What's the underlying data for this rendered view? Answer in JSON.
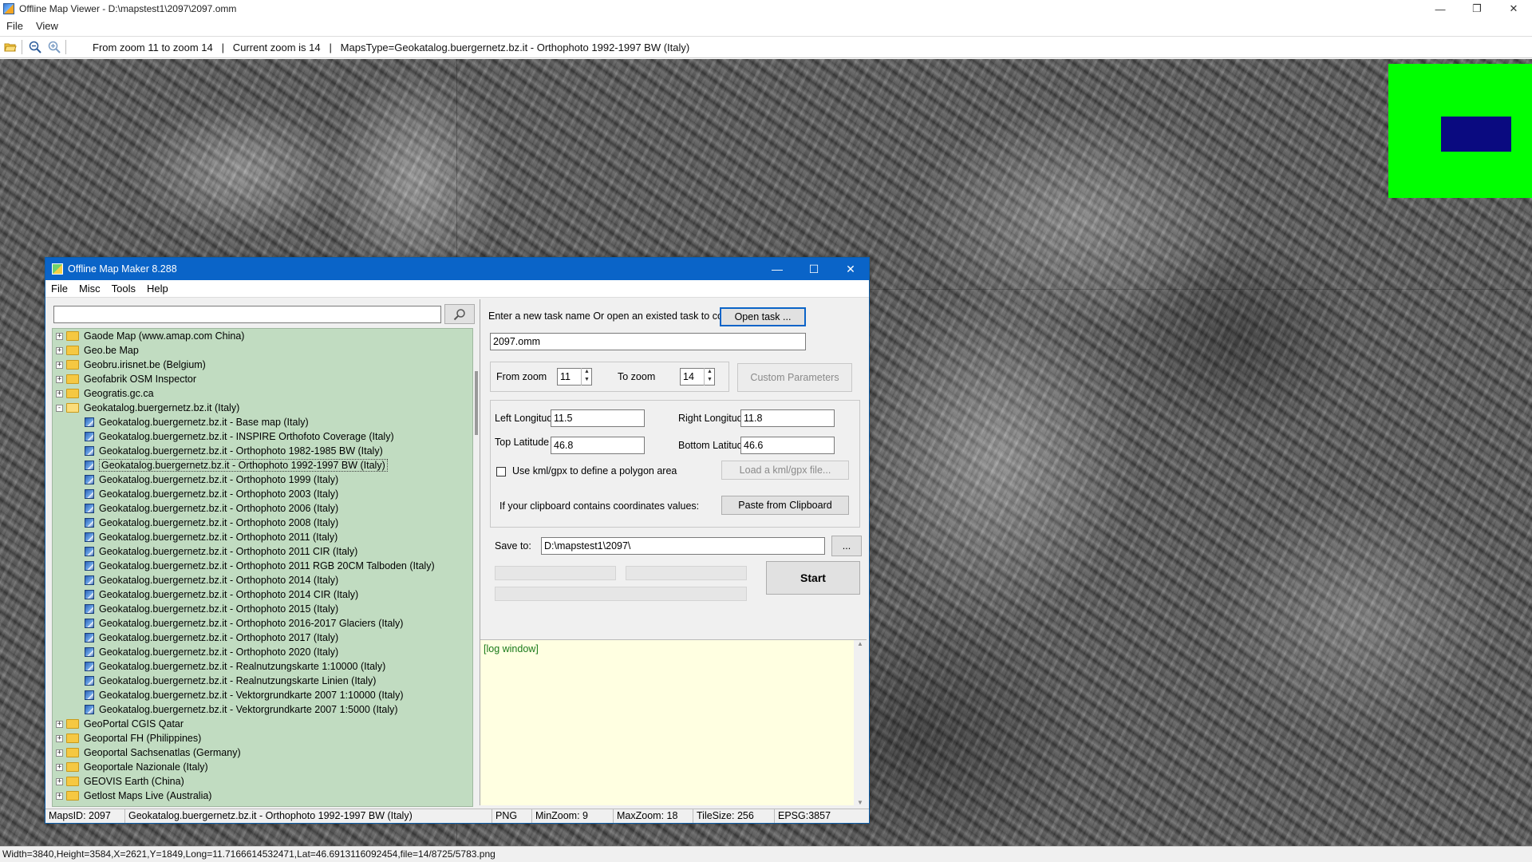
{
  "viewer": {
    "title": "Offline Map Viewer - D:\\mapstest1\\2097\\2097.omm",
    "menu": [
      "File",
      "View"
    ],
    "toolbar_status": "From zoom 11 to zoom 14   |   Current zoom is 14   |   MapsType=Geokatalog.buergernetz.bz.it - Orthophoto 1992-1997 BW (Italy)",
    "statusbar": "Width=3840,Height=3584,X=2621,Y=1849,Long=11.7166614532471,Lat=46.6913116092454,file=14/8725/5783.png",
    "icons": {
      "open": "folder-open-icon",
      "zoom_out": "zoom-out-icon",
      "zoom_in": "zoom-in-icon"
    },
    "colors": {
      "minimap_bg": "#00ff00",
      "minimap_viewport": "#0a0a80"
    }
  },
  "dialog": {
    "title": "Offline Map Maker 8.288",
    "menu": [
      "File",
      "Misc",
      "Tools",
      "Help"
    ],
    "search": {
      "value": "",
      "placeholder": ""
    },
    "tree": [
      {
        "label": "Gaode Map (www.amap.com China)",
        "type": "folder",
        "expanded": false
      },
      {
        "label": "Geo.be Map",
        "type": "folder",
        "expanded": false
      },
      {
        "label": "Geobru.irisnet.be (Belgium)",
        "type": "folder",
        "expanded": false
      },
      {
        "label": "Geofabrik OSM Inspector",
        "type": "folder",
        "expanded": false
      },
      {
        "label": "Geogratis.gc.ca",
        "type": "folder",
        "expanded": false
      },
      {
        "label": "Geokatalog.buergernetz.bz.it (Italy)",
        "type": "folder",
        "expanded": true
      },
      {
        "label": "Geokatalog.buergernetz.bz.it - Base map (Italy)",
        "type": "map"
      },
      {
        "label": "Geokatalog.buergernetz.bz.it - INSPIRE Orthofoto Coverage (Italy)",
        "type": "map"
      },
      {
        "label": "Geokatalog.buergernetz.bz.it - Orthophoto 1982-1985 BW (Italy)",
        "type": "map"
      },
      {
        "label": "Geokatalog.buergernetz.bz.it - Orthophoto 1992-1997 BW (Italy)",
        "type": "map",
        "selected": true
      },
      {
        "label": "Geokatalog.buergernetz.bz.it - Orthophoto 1999 (Italy)",
        "type": "map"
      },
      {
        "label": "Geokatalog.buergernetz.bz.it - Orthophoto 2003 (Italy)",
        "type": "map"
      },
      {
        "label": "Geokatalog.buergernetz.bz.it - Orthophoto 2006 (Italy)",
        "type": "map"
      },
      {
        "label": "Geokatalog.buergernetz.bz.it - Orthophoto 2008 (Italy)",
        "type": "map"
      },
      {
        "label": "Geokatalog.buergernetz.bz.it - Orthophoto 2011 (Italy)",
        "type": "map"
      },
      {
        "label": "Geokatalog.buergernetz.bz.it - Orthophoto 2011 CIR (Italy)",
        "type": "map"
      },
      {
        "label": "Geokatalog.buergernetz.bz.it - Orthophoto 2011 RGB 20CM Talboden (Italy)",
        "type": "map"
      },
      {
        "label": "Geokatalog.buergernetz.bz.it - Orthophoto 2014 (Italy)",
        "type": "map"
      },
      {
        "label": "Geokatalog.buergernetz.bz.it - Orthophoto 2014 CIR (Italy)",
        "type": "map"
      },
      {
        "label": "Geokatalog.buergernetz.bz.it - Orthophoto 2015 (Italy)",
        "type": "map"
      },
      {
        "label": "Geokatalog.buergernetz.bz.it - Orthophoto 2016-2017 Glaciers (Italy)",
        "type": "map"
      },
      {
        "label": "Geokatalog.buergernetz.bz.it - Orthophoto 2017 (Italy)",
        "type": "map"
      },
      {
        "label": "Geokatalog.buergernetz.bz.it - Orthophoto 2020 (Italy)",
        "type": "map"
      },
      {
        "label": "Geokatalog.buergernetz.bz.it - Realnutzungskarte 1:10000 (Italy)",
        "type": "map"
      },
      {
        "label": "Geokatalog.buergernetz.bz.it - Realnutzungskarte Linien (Italy)",
        "type": "map"
      },
      {
        "label": "Geokatalog.buergernetz.bz.it - Vektorgrundkarte 2007 1:10000 (Italy)",
        "type": "map"
      },
      {
        "label": "Geokatalog.buergernetz.bz.it - Vektorgrundkarte 2007 1:5000 (Italy)",
        "type": "map"
      },
      {
        "label": "GeoPortal CGIS Qatar",
        "type": "folder",
        "expanded": false
      },
      {
        "label": "Geoportal FH (Philippines)",
        "type": "folder",
        "expanded": false
      },
      {
        "label": "Geoportal Sachsenatlas (Germany)",
        "type": "folder",
        "expanded": false
      },
      {
        "label": "Geoportale Nazionale (Italy)",
        "type": "folder",
        "expanded": false
      },
      {
        "label": "GEOVIS Earth (China)",
        "type": "folder",
        "expanded": false
      },
      {
        "label": "Getlost Maps Live (Australia)",
        "type": "folder",
        "expanded": false
      }
    ],
    "task": {
      "prompt": "Enter a new task name Or open an existed task to continue:",
      "open_label": "Open task ...",
      "name": "2097.omm"
    },
    "zoom": {
      "from_label": "From zoom",
      "from_value": "11",
      "to_label": "To zoom",
      "to_value": "14",
      "custom_label": "Custom Parameters"
    },
    "coords": {
      "left_lon_label": "Left Longitude",
      "left_lon": "11.5",
      "right_lon_label": "Right Longitude",
      "right_lon": "11.8",
      "top_lat_label": "Top Latitude",
      "top_lat": "46.8",
      "bottom_lat_label": "Bottom Latitude",
      "bottom_lat": "46.6",
      "kml_label": "Use kml/gpx to define a polygon area",
      "kml_checked": false,
      "load_kml_label": "Load a kml/gpx file...",
      "clipboard_label": "If your clipboard contains coordinates values:",
      "paste_label": "Paste from Clipboard"
    },
    "save": {
      "label": "Save to:",
      "path": "D:\\mapstest1\\2097\\",
      "browse": "..."
    },
    "start_label": "Start",
    "log": "[log window]",
    "status": {
      "maps_id": "MapsID: 2097",
      "name": "Geokatalog.buergernetz.bz.it - Orthophoto 1992-1997 BW (Italy)",
      "format": "PNG",
      "min_zoom": "MinZoom: 9",
      "max_zoom": "MaxZoom: 18",
      "tile_size": "TileSize: 256",
      "epsg": "EPSG:3857"
    }
  }
}
